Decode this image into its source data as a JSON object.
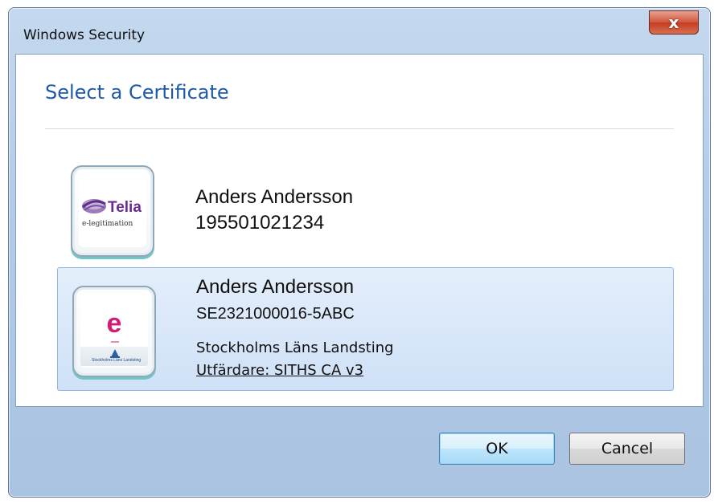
{
  "window": {
    "title": "Windows Security",
    "close_label": "x"
  },
  "dialog": {
    "heading": "Select a Certificate"
  },
  "certificates": [
    {
      "logo_text": "Telia",
      "logo_subtext": "e-legitimation",
      "name": "Anders Andersson",
      "identifier": "195501021234",
      "selected": false
    },
    {
      "logo_text": "e",
      "logo_subtext": "Stockholms Läns Landsting",
      "name": "Anders Andersson",
      "identifier": "SE2321000016-5ABC",
      "organization": "Stockholms Läns Landsting",
      "issuer": "Utfärdare: SITHS CA v3",
      "selected": true
    }
  ],
  "buttons": {
    "ok": "OK",
    "cancel": "Cancel"
  },
  "colors": {
    "heading": "#1e5aa8",
    "selection": "#cfe1f7",
    "close": "#c23d23",
    "telia_purple": "#6b2a91",
    "siths_pink": "#d31b74"
  },
  "icons": [
    "close-icon",
    "telia-logo-icon",
    "siths-card-icon",
    "sll-logo-icon"
  ]
}
